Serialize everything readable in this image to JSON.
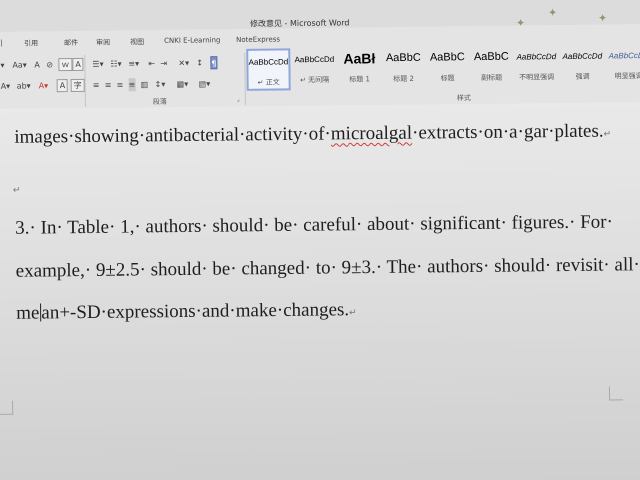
{
  "window": {
    "title": "修改意见 - Microsoft Word"
  },
  "ribbon": {
    "tabs": [
      "引用",
      "邮件",
      "审阅",
      "视图",
      "CNKI E-Learning",
      "NoteExpress"
    ],
    "font_tools": [
      "Aa▾",
      "A",
      "A",
      "Aa▾",
      "A",
      "ｗ",
      "A"
    ],
    "font_row2": [
      "A▾",
      "ab▾",
      "A▾",
      "A",
      "A",
      "字"
    ],
    "para_row1": [
      "☰▾",
      "☷▾",
      "≡▾",
      "⇤",
      "⇥",
      "✕▾",
      "↕",
      "¶"
    ],
    "para_row2": [
      "≡",
      "≡",
      "≡",
      "≡",
      "▥",
      "↕▾",
      "▦▾",
      "▤▾"
    ],
    "group_labels": {
      "paragraph": "段落",
      "styles": "样式"
    },
    "styles": [
      {
        "sample": "AaBbCcDd",
        "name": "↵ 正文"
      },
      {
        "sample": "AaBbCcDd",
        "name": "↵ 无间隔"
      },
      {
        "sample": "AaBł",
        "name": "标题 1"
      },
      {
        "sample": "AaBbC",
        "name": "标题 2"
      },
      {
        "sample": "AaBbC",
        "name": "标题"
      },
      {
        "sample": "AaBbC",
        "name": "副标题"
      },
      {
        "sample": "AaBbCcDd",
        "name": "不明显强调"
      },
      {
        "sample": "AaBbCcDd",
        "name": "强调"
      },
      {
        "sample": "AaBbCcDe",
        "name": "明显强调"
      }
    ]
  },
  "document": {
    "line1_before": "images·showing·antibacterial·activity·of·",
    "line1_misspelled": "microalgal",
    "line1_after": "·extracts·on·a·gar·plates.",
    "empty_para_mark": "↵",
    "line3": "3.· In· Table· 1,· authors· should· be· careful· about· significant· figures.· For·",
    "line4": "example,· 9±2.5· should· be· changed· to· 9±3.· The· authors· should· revisit· all·",
    "line5_before_caret": "me",
    "line5_after_caret": "an+-SD·expressions·and·make·changes."
  },
  "colors": {
    "spellcheck_underline": "#d23a3a",
    "selected_style_border": "#8fa6d9",
    "document_background": "#e9e9e9"
  }
}
